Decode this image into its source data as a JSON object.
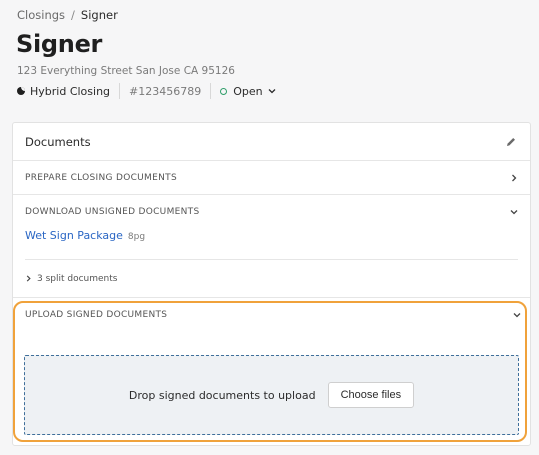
{
  "breadcrumb": {
    "parent": "Closings",
    "separator": "/",
    "current": "Signer"
  },
  "page": {
    "title": "Signer",
    "address": "123 Everything Street San Jose CA 95126"
  },
  "meta": {
    "closing_type": "Hybrid Closing",
    "closing_id": "#123456789",
    "status": "Open",
    "status_color": "#2f9e6a"
  },
  "documents": {
    "title": "Documents",
    "sections": {
      "prepare": "PREPARE CLOSING DOCUMENTS",
      "download": "DOWNLOAD UNSIGNED DOCUMENTS",
      "upload": "UPLOAD SIGNED DOCUMENTS"
    },
    "package": {
      "name": "Wet Sign Package",
      "pages": "8pg"
    },
    "split_documents": "3 split documents",
    "upload": {
      "drop_text": "Drop signed documents to upload",
      "button_label": "Choose files"
    }
  },
  "colors": {
    "link": "#2a66c4",
    "highlight": "#f0a23b",
    "dropzone_border": "#3f6f9a"
  },
  "icons": [
    "hybrid-closing-icon",
    "status-dot-icon",
    "chevron-down-icon",
    "pencil-icon",
    "chevron-right-icon"
  ]
}
